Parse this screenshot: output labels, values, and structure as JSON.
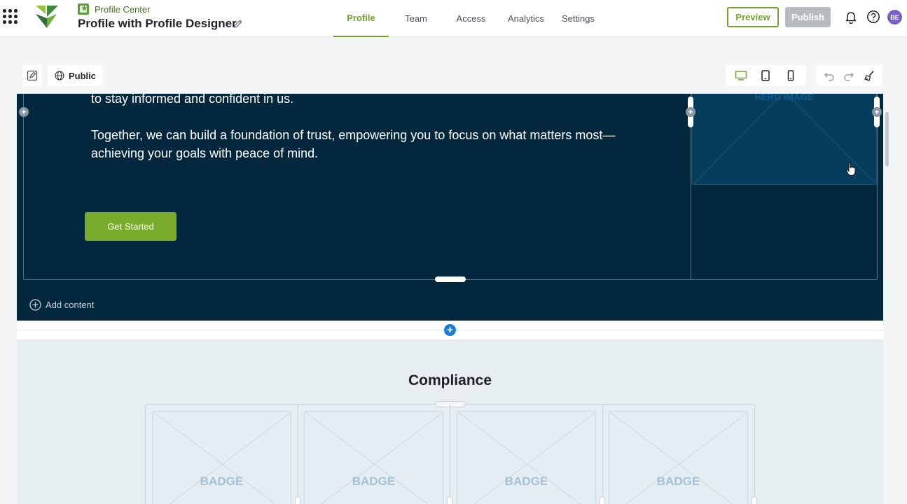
{
  "header": {
    "breadcrumb": "Profile Center",
    "title": "Profile with Profile Designer",
    "tabs": [
      {
        "label": "Profile",
        "active": true
      },
      {
        "label": "Team",
        "active": false
      },
      {
        "label": "Access",
        "active": false
      },
      {
        "label": "Analytics",
        "active": false
      },
      {
        "label": "Settings",
        "active": false
      }
    ],
    "preview_label": "Preview",
    "publish_label": "Publish",
    "avatar_initials": "BE"
  },
  "toolbar": {
    "visibility_label": "Public",
    "active_device": "desktop"
  },
  "hero": {
    "paragraph_1": "to stay informed and confident in us.",
    "paragraph_2": "Together, we can build a foundation of trust, empowering you to focus on what matters most—achieving your goals with peace of mind.",
    "cta_label": "Get Started",
    "image_placeholder": "HERO IMAGE",
    "add_content_label": "Add content"
  },
  "compliance": {
    "title": "Compliance",
    "badges": [
      "BADGE",
      "BADGE",
      "BADGE",
      "BADGE"
    ]
  },
  "colors": {
    "brand_green": "#6ea42c",
    "hero_bg": "#03273d",
    "cta_green": "#79ac2b",
    "add_blue": "#1a7fd4"
  }
}
